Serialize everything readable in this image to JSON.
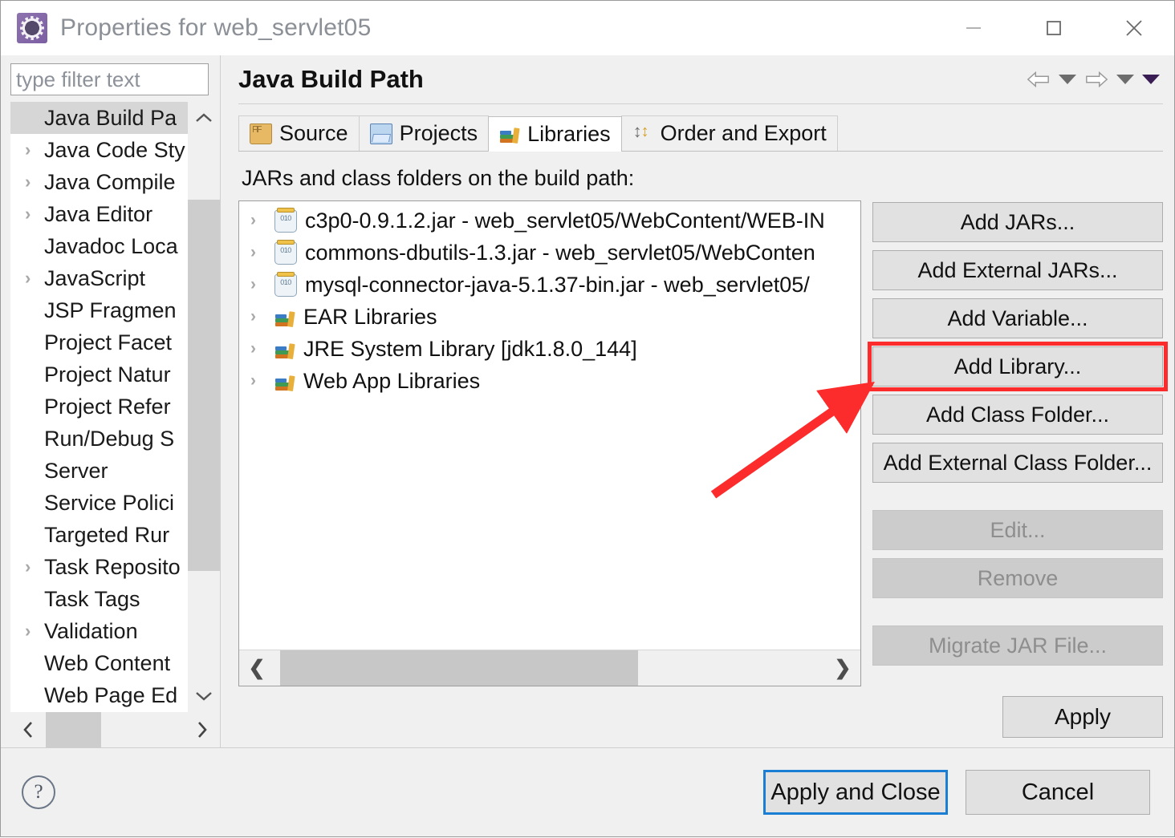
{
  "window": {
    "title": "Properties for web_servlet05",
    "icon": "properties-gear-icon",
    "minimize_label": "Minimize",
    "maximize_label": "Maximize",
    "close_label": "Close"
  },
  "sidebar": {
    "filter": {
      "value": "",
      "placeholder": "type filter text"
    },
    "items": [
      {
        "label": "Java Build Pa",
        "expandable": false,
        "selected": true
      },
      {
        "label": "Java Code Sty",
        "expandable": true,
        "selected": false
      },
      {
        "label": "Java Compile",
        "expandable": true,
        "selected": false
      },
      {
        "label": "Java Editor",
        "expandable": true,
        "selected": false
      },
      {
        "label": "Javadoc Loca",
        "expandable": false,
        "selected": false
      },
      {
        "label": "JavaScript",
        "expandable": true,
        "selected": false
      },
      {
        "label": "JSP Fragmen",
        "expandable": false,
        "selected": false
      },
      {
        "label": "Project Facet",
        "expandable": false,
        "selected": false
      },
      {
        "label": "Project Natur",
        "expandable": false,
        "selected": false
      },
      {
        "label": "Project Refer",
        "expandable": false,
        "selected": false
      },
      {
        "label": "Run/Debug S",
        "expandable": false,
        "selected": false
      },
      {
        "label": "Server",
        "expandable": false,
        "selected": false
      },
      {
        "label": "Service Polici",
        "expandable": false,
        "selected": false
      },
      {
        "label": "Targeted Rur",
        "expandable": false,
        "selected": false
      },
      {
        "label": "Task Reposito",
        "expandable": true,
        "selected": false
      },
      {
        "label": "Task Tags",
        "expandable": false,
        "selected": false
      },
      {
        "label": "Validation",
        "expandable": true,
        "selected": false
      },
      {
        "label": "Web Content",
        "expandable": false,
        "selected": false
      },
      {
        "label": "Web Page Ed",
        "expandable": false,
        "selected": false
      }
    ],
    "scroll_up": "⌃",
    "scroll_down": "⌄",
    "scroll_left": "‹",
    "scroll_right": "›"
  },
  "page": {
    "title": "Java Build Path",
    "nav": {
      "back": "back-arrow",
      "back_menu": "back-dropdown",
      "forward": "forward-arrow",
      "forward_menu": "forward-dropdown",
      "more_menu": "more-dropdown"
    }
  },
  "tabs": [
    {
      "label": "Source",
      "icon": "source-package-icon",
      "active": false
    },
    {
      "label": "Projects",
      "icon": "projects-folder-icon",
      "active": false
    },
    {
      "label": "Libraries",
      "icon": "libraries-books-icon",
      "active": true
    },
    {
      "label": "Order and Export",
      "icon": "order-export-arrows-icon",
      "active": false
    }
  ],
  "libraries_tab": {
    "section_label": "JARs and class folders on the build path:",
    "entries": [
      {
        "label": "c3p0-0.9.1.2.jar - web_servlet05/WebContent/WEB-IN",
        "icon": "jar-icon",
        "expandable": true
      },
      {
        "label": "commons-dbutils-1.3.jar - web_servlet05/WebConten",
        "icon": "jar-icon",
        "expandable": true
      },
      {
        "label": "mysql-connector-java-5.1.37-bin.jar - web_servlet05/",
        "icon": "jar-icon",
        "expandable": true
      },
      {
        "label": "EAR Libraries",
        "icon": "library-books-icon",
        "expandable": true
      },
      {
        "label": "JRE System Library [jdk1.8.0_144]",
        "icon": "library-books-icon",
        "expandable": true
      },
      {
        "label": "Web App Libraries",
        "icon": "library-books-icon",
        "expandable": true
      }
    ],
    "scroll_left": "❮",
    "scroll_right": "❯",
    "buttons": [
      {
        "label": "Add JARs...",
        "enabled": true,
        "highlighted": false
      },
      {
        "label": "Add External JARs...",
        "enabled": true,
        "highlighted": false
      },
      {
        "label": "Add Variable...",
        "enabled": true,
        "highlighted": false
      },
      {
        "label": "Add Library...",
        "enabled": true,
        "highlighted": true
      },
      {
        "label": "Add Class Folder...",
        "enabled": true,
        "highlighted": false
      },
      {
        "label": "Add External Class Folder...",
        "enabled": true,
        "highlighted": false
      },
      {
        "label": "Edit...",
        "enabled": false,
        "highlighted": false
      },
      {
        "label": "Remove",
        "enabled": false,
        "highlighted": false
      },
      {
        "label": "Migrate JAR File...",
        "enabled": false,
        "highlighted": false
      }
    ],
    "apply_label": "Apply"
  },
  "footer": {
    "help_icon": "help-question-icon",
    "apply_and_close_label": "Apply and Close",
    "cancel_label": "Cancel"
  },
  "annotation": {
    "highlight_color": "#fc2c2c",
    "arrow_target": "Add Library..."
  }
}
